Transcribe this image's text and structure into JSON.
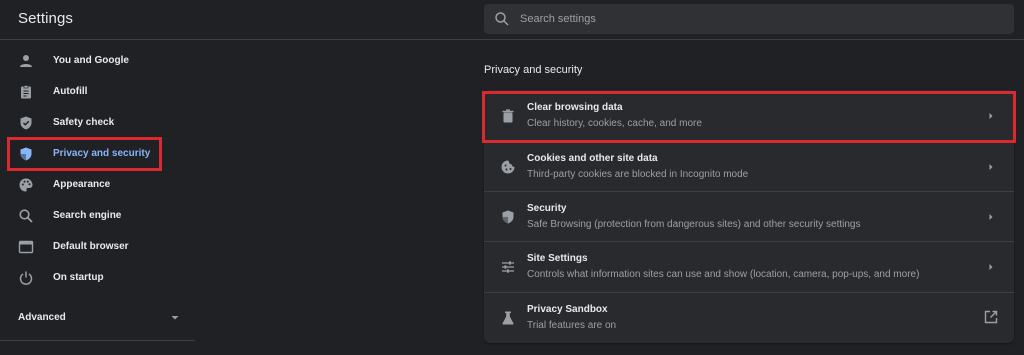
{
  "app": {
    "title": "Settings"
  },
  "search": {
    "placeholder": "Search settings"
  },
  "sidebar": {
    "items": [
      {
        "label": "You and Google",
        "icon": "person-icon"
      },
      {
        "label": "Autofill",
        "icon": "clipboard-icon"
      },
      {
        "label": "Safety check",
        "icon": "shield-check-icon"
      },
      {
        "label": "Privacy and security",
        "icon": "shield-icon",
        "selected": true
      },
      {
        "label": "Appearance",
        "icon": "palette-icon"
      },
      {
        "label": "Search engine",
        "icon": "search-icon"
      },
      {
        "label": "Default browser",
        "icon": "browser-icon"
      },
      {
        "label": "On startup",
        "icon": "power-icon"
      }
    ],
    "advanced_label": "Advanced"
  },
  "main": {
    "section_title": "Privacy and security",
    "rows": [
      {
        "title": "Clear browsing data",
        "subtitle": "Clear history, cookies, cache, and more",
        "icon": "trash-icon",
        "action": "chevron-right-icon"
      },
      {
        "title": "Cookies and other site data",
        "subtitle": "Third-party cookies are blocked in Incognito mode",
        "icon": "cookie-icon",
        "action": "chevron-right-icon"
      },
      {
        "title": "Security",
        "subtitle": "Safe Browsing (protection from dangerous sites) and other security settings",
        "icon": "security-shield-icon",
        "action": "chevron-right-icon"
      },
      {
        "title": "Site Settings",
        "subtitle": "Controls what information sites can use and show (location, camera, pop-ups, and more)",
        "icon": "sliders-icon",
        "action": "chevron-right-icon"
      },
      {
        "title": "Privacy Sandbox",
        "subtitle": "Trial features are on",
        "icon": "flask-icon",
        "action": "external-link-icon"
      }
    ]
  },
  "colors": {
    "background": "#202124",
    "card": "#292a2d",
    "accent": "#8ab4f8",
    "highlight": "#d92b2f",
    "text_secondary": "#9aa0a6"
  }
}
